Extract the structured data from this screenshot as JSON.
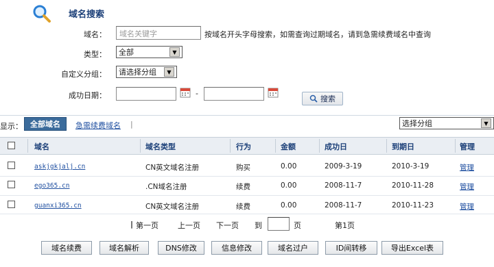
{
  "search": {
    "title": "域名搜索",
    "domain_label": "域名：",
    "domain_placeholder": "域名关键字",
    "domain_hint": "按域名开头字母搜索，如需查询过期域名，请到急需续费域名中查询",
    "type_label": "类型：",
    "type_value": "全部",
    "group_label": "自定义分组：",
    "group_value": "请选择分组",
    "date_label": "成功日期：",
    "date_separator": "-",
    "button_label": "搜索"
  },
  "filter": {
    "show_label": "显示：",
    "tab_active": "全部域名",
    "tab_link": "急需续费域名",
    "separator": "|",
    "group_select": "选择分组"
  },
  "table": {
    "columns": [
      "域名",
      "域名类型",
      "行为",
      "金额",
      "成功日",
      "到期日",
      "管理"
    ],
    "rows": [
      {
        "domain": "askjgkjalj.cn",
        "type": "CN英文域名注册",
        "action": "购买",
        "amount": "0.00",
        "success": "2009-3-19",
        "expire": "2010-3-19",
        "manage": "管理"
      },
      {
        "domain": "ego365.cn",
        "type": ".CN域名注册",
        "action": "续费",
        "amount": "0.00",
        "success": "2008-11-7",
        "expire": "2010-11-28",
        "manage": "管理"
      },
      {
        "domain": "guanxi365.cn",
        "type": "CN英文域名注册",
        "action": "续费",
        "amount": "0.00",
        "success": "2008-11-7",
        "expire": "2010-11-23",
        "manage": "管理"
      }
    ]
  },
  "pager": {
    "first": "第一页",
    "prev": "上一页",
    "next": "下一页",
    "goto": "到",
    "page_unit": "页",
    "current": "第1页"
  },
  "actions": [
    "域名续费",
    "域名解析",
    "DNS修改",
    "信息修改",
    "域名过户",
    "ID间转移",
    "导出Excel表"
  ],
  "colors": {
    "accent": "#3b6b9b",
    "link": "#1f4fa0",
    "header_bg": "#eaeef3"
  }
}
